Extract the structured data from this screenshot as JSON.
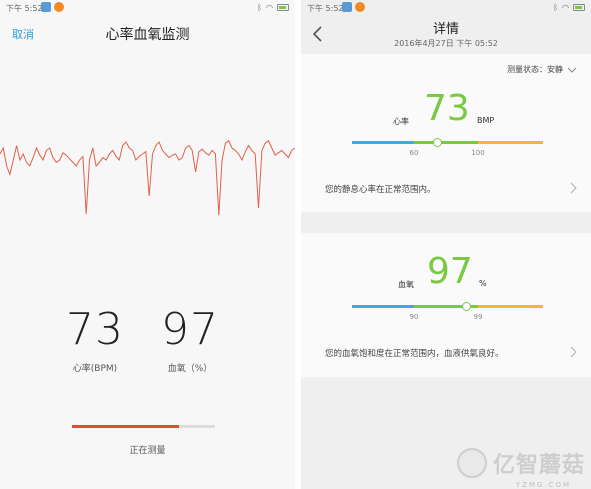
{
  "left": {
    "status": {
      "time": "下午 5:52"
    },
    "header": {
      "cancel_label": "取消",
      "title": "心率血氧监测"
    },
    "ecg_series": [
      0.45,
      0.4,
      0.55,
      0.62,
      0.5,
      0.38,
      0.5,
      0.45,
      0.52,
      0.55,
      0.48,
      0.4,
      0.46,
      0.5,
      0.42,
      0.4,
      0.48,
      0.52,
      0.5,
      0.44,
      0.46,
      0.49,
      0.52,
      0.55,
      0.5,
      0.47,
      0.95,
      0.5,
      0.4,
      0.55,
      0.52,
      0.48,
      0.5,
      0.45,
      0.42,
      0.47,
      0.5,
      0.38,
      0.35,
      0.4,
      0.42,
      0.5,
      0.47,
      0.45,
      0.43,
      0.8,
      0.45,
      0.38,
      0.35,
      0.42,
      0.45,
      0.48,
      0.46,
      0.45,
      0.5,
      0.48,
      0.4,
      0.38,
      0.42,
      0.6,
      0.43,
      0.41,
      0.44,
      0.46,
      0.42,
      0.45,
      0.96,
      0.5,
      0.36,
      0.34,
      0.4,
      0.42,
      0.45,
      0.5,
      0.43,
      0.38,
      0.42,
      0.45,
      0.9,
      0.42,
      0.36,
      0.34,
      0.4,
      0.46,
      0.44,
      0.42,
      0.45,
      0.48,
      0.42,
      0.4
    ],
    "ecg_color": "#e0614a",
    "heart_rate": {
      "value": "73",
      "label": "心率(BPM)"
    },
    "spo2": {
      "value": "97",
      "label": "血氧（%）"
    },
    "progress": 0.75,
    "progress_color": "#e04d32",
    "measuring_text": "正在测量"
  },
  "right": {
    "status": {
      "time": "下午 5:52"
    },
    "header": {
      "title": "详情",
      "date": "2016年4月27日 下午 05:52"
    },
    "heart_card": {
      "state_label": "测量状态：安静",
      "value_label": "心率",
      "value": "73",
      "unit": "BMP",
      "tick_low": "60",
      "tick_high": "100",
      "level": 0.45,
      "description": "您的静息心率在正常范围内。"
    },
    "spo2_card": {
      "value_label": "血氧",
      "value": "97",
      "unit": "%",
      "tick_low": "90",
      "tick_high": "99",
      "level": 0.6,
      "description": "您的血氧饱和度在正常范围内，血液供氧良好。"
    }
  },
  "colors": {
    "accent_blue": "#2f9be8",
    "gauge_blue": "#40a9e0",
    "gauge_green": "#7ac943",
    "gauge_orange": "#f4b63a"
  },
  "watermark": {
    "text": "亿智蘑菇",
    "sub": "YZMG.COM"
  }
}
